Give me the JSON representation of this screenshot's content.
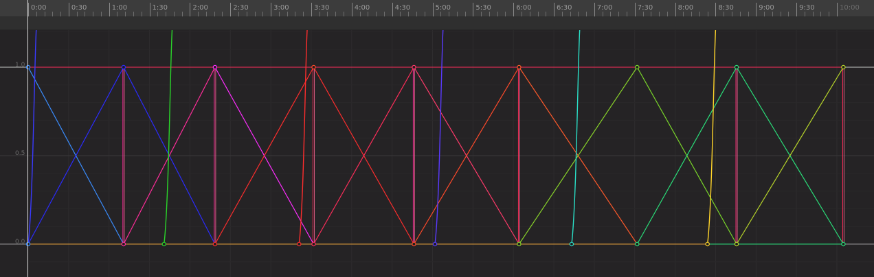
{
  "ruler": {
    "labels": [
      "0:00",
      "0:30",
      "1:00",
      "1:30",
      "2:00",
      "2:30",
      "3:00",
      "3:30",
      "4:00",
      "4:30",
      "5:00",
      "5:30",
      "6:00",
      "6:30",
      "7:00",
      "7:30",
      "8:00",
      "8:30",
      "9:00",
      "9:30",
      "10:00"
    ]
  },
  "value_axis": {
    "labels": [
      "1.0",
      "0.5",
      "0.0"
    ]
  },
  "colors": {
    "grid": "#2e2c2e",
    "minor_grid": "#2a282a",
    "baseline": "#e8a23a",
    "limit": "#ff2d5a"
  },
  "curves": [
    {
      "color": "#3a8dff",
      "points": [
        [
          0,
          1
        ],
        [
          1.18,
          0
        ]
      ]
    },
    {
      "color": "#2b2bff",
      "points": [
        [
          0,
          0
        ],
        [
          1.18,
          1
        ]
      ]
    },
    {
      "color": "#2b2bff",
      "points": [
        [
          1.18,
          1
        ],
        [
          2.31,
          0
        ]
      ]
    },
    {
      "color": "#ff2d9a",
      "points": [
        [
          1.18,
          0
        ],
        [
          2.31,
          1
        ]
      ]
    },
    {
      "color": "#ff2dff",
      "points": [
        [
          2.31,
          1
        ],
        [
          3.53,
          0
        ]
      ]
    },
    {
      "color": "#ff2d2d",
      "points": [
        [
          2.31,
          0
        ],
        [
          3.53,
          1
        ]
      ]
    },
    {
      "color": "#ff2d2d",
      "points": [
        [
          3.53,
          1
        ],
        [
          4.77,
          0
        ]
      ]
    },
    {
      "color": "#ff2d5a",
      "points": [
        [
          3.53,
          0
        ],
        [
          4.77,
          1
        ]
      ]
    },
    {
      "color": "#ff3a6a",
      "points": [
        [
          4.77,
          1
        ],
        [
          6.07,
          0
        ]
      ]
    },
    {
      "color": "#ff4a2a",
      "points": [
        [
          4.77,
          0
        ],
        [
          6.07,
          1
        ]
      ]
    },
    {
      "color": "#ff5a2a",
      "points": [
        [
          6.07,
          1
        ],
        [
          7.53,
          0
        ]
      ]
    },
    {
      "color": "#8ad62a",
      "points": [
        [
          6.07,
          0
        ],
        [
          7.53,
          1
        ]
      ]
    },
    {
      "color": "#7ad62a",
      "points": [
        [
          7.53,
          1
        ],
        [
          8.76,
          0
        ]
      ]
    },
    {
      "color": "#2adf7a",
      "points": [
        [
          7.53,
          0
        ],
        [
          8.76,
          1
        ]
      ]
    },
    {
      "color": "#2adf7a",
      "points": [
        [
          8.76,
          1
        ],
        [
          10.08,
          0
        ]
      ]
    },
    {
      "color": "#b8d62a",
      "points": [
        [
          8.76,
          0
        ],
        [
          10.08,
          1
        ]
      ]
    }
  ],
  "ease_curves": [
    {
      "color": "#3a3aff",
      "x0": 0.0,
      "x1": 0.1
    },
    {
      "color": "#2ad62a",
      "x0": 1.68,
      "x1": 1.78
    },
    {
      "color": "#ff2d2d",
      "x0": 3.35,
      "x1": 3.45
    },
    {
      "color": "#5a3aff",
      "x0": 5.03,
      "x1": 5.13
    },
    {
      "color": "#2ae0c8",
      "x0": 6.72,
      "x1": 6.82
    },
    {
      "color": "#ffd42a",
      "x0": 8.4,
      "x1": 8.5
    }
  ],
  "verticals": [
    {
      "x": 1.18,
      "color": "#ff2d9a"
    },
    {
      "x": 2.31,
      "color": "#ff2d9a"
    },
    {
      "x": 3.53,
      "color": "#ff2d5a"
    },
    {
      "x": 4.77,
      "color": "#ff2d9a"
    },
    {
      "x": 6.07,
      "color": "#ff2d5a"
    },
    {
      "x": 8.76,
      "color": "#ff2d7a"
    },
    {
      "x": 10.08,
      "color": "#ff2d5a"
    }
  ],
  "keyframes": [
    {
      "x": 0,
      "y": 1,
      "color": "#3a8dff"
    },
    {
      "x": 0,
      "y": 0,
      "color": "#3a8dff"
    },
    {
      "x": 1.18,
      "y": 1,
      "color": "#2b2bff"
    },
    {
      "x": 1.18,
      "y": 0,
      "color": "#ff2d9a"
    },
    {
      "x": 1.68,
      "y": 0,
      "color": "#2ad62a"
    },
    {
      "x": 2.31,
      "y": 1,
      "color": "#ff2dff"
    },
    {
      "x": 2.31,
      "y": 0,
      "color": "#ff2d2d"
    },
    {
      "x": 3.35,
      "y": 0,
      "color": "#ff2d2d"
    },
    {
      "x": 3.53,
      "y": 1,
      "color": "#ff4a2a"
    },
    {
      "x": 3.53,
      "y": 0,
      "color": "#ff2d5a"
    },
    {
      "x": 4.77,
      "y": 1,
      "color": "#ff3a6a"
    },
    {
      "x": 4.77,
      "y": 0,
      "color": "#ff4a2a"
    },
    {
      "x": 5.03,
      "y": 0,
      "color": "#5a3aff"
    },
    {
      "x": 6.07,
      "y": 1,
      "color": "#ff5a2a"
    },
    {
      "x": 6.07,
      "y": 0,
      "color": "#8ad62a"
    },
    {
      "x": 6.72,
      "y": 0,
      "color": "#2ae0c8"
    },
    {
      "x": 7.53,
      "y": 1,
      "color": "#7ad62a"
    },
    {
      "x": 7.53,
      "y": 0,
      "color": "#2adf7a"
    },
    {
      "x": 8.4,
      "y": 0,
      "color": "#ffd42a"
    },
    {
      "x": 8.76,
      "y": 1,
      "color": "#2adf7a"
    },
    {
      "x": 8.76,
      "y": 0,
      "color": "#b8d62a"
    },
    {
      "x": 10.08,
      "y": 1,
      "color": "#b8d62a"
    },
    {
      "x": 10.08,
      "y": 0,
      "color": "#2adf7a"
    }
  ]
}
